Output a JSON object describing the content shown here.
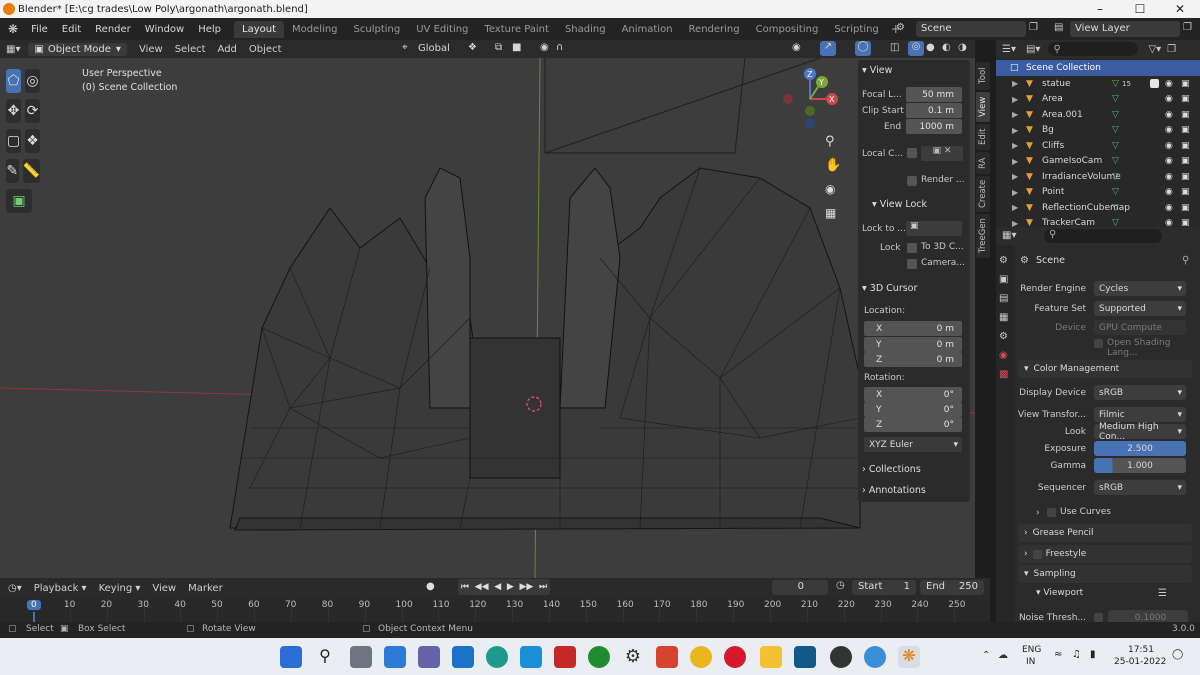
{
  "window": {
    "title": "Blender* [E:\\cg trades\\Low Poly\\argonath\\argonath.blend]"
  },
  "menu": [
    "File",
    "Edit",
    "Render",
    "Window",
    "Help"
  ],
  "workspaces": [
    "Layout",
    "Modeling",
    "Sculpting",
    "UV Editing",
    "Texture Paint",
    "Shading",
    "Animation",
    "Rendering",
    "Compositing",
    "Scripting"
  ],
  "active_workspace": "Layout",
  "scene_name": "Scene",
  "view_layer": "View Layer",
  "viewport_header": {
    "mode": "Object Mode",
    "menus": [
      "View",
      "Select",
      "Add",
      "Object"
    ],
    "orientation": "Global"
  },
  "viewport_overlay": {
    "line1": "User Perspective",
    "line2": "(0) Scene Collection"
  },
  "npanel": {
    "view_title": "View",
    "focal_label": "Focal L...",
    "focal_value": "50 mm",
    "clip_start_label": "Clip Start",
    "clip_start_value": "0.1 m",
    "end_label": "End",
    "end_value": "1000 m",
    "local_camera_label": "Local C...",
    "render_region_label": "Render ...",
    "view_lock_title": "View Lock",
    "lock_to_label": "Lock to ...",
    "lock_label": "Lock",
    "to_3d_cursor": "To 3D C...",
    "camera_label": "Camera...",
    "cursor_title": "3D Cursor",
    "location_label": "Location:",
    "loc": [
      {
        "axis": "X",
        "value": "0 m"
      },
      {
        "axis": "Y",
        "value": "0 m"
      },
      {
        "axis": "Z",
        "value": "0 m"
      }
    ],
    "rotation_label": "Rotation:",
    "rot": [
      {
        "axis": "X",
        "value": "0°"
      },
      {
        "axis": "Y",
        "value": "0°"
      },
      {
        "axis": "Z",
        "value": "0°"
      }
    ],
    "rotation_mode": "XYZ Euler",
    "collections_label": "Collections",
    "annotations_label": "Annotations"
  },
  "side_tabs": [
    "Tool",
    "View",
    "Edit",
    "RA",
    "Create",
    "TreeGen"
  ],
  "outliner": {
    "root": "Scene Collection",
    "items": [
      "statue",
      "Area",
      "Area.001",
      "Bg",
      "Cliffs",
      "GameIsoCam",
      "IrradianceVolume",
      "Point",
      "ReflectionCubemap",
      "TrackerCam"
    ],
    "statue_badge": "15"
  },
  "properties": {
    "context": "Scene",
    "render_engine_label": "Render Engine",
    "render_engine": "Cycles",
    "feature_set_label": "Feature Set",
    "feature_set": "Supported",
    "device_label": "Device",
    "device": "GPU Compute",
    "osl_label": "Open Shading Lang...",
    "color_mgmt_title": "Color Management",
    "display_device_label": "Display Device",
    "display_device": "sRGB",
    "view_transform_label": "View Transfor...",
    "view_transform": "Filmic",
    "look_label": "Look",
    "look": "Medium High Con...",
    "exposure_label": "Exposure",
    "exposure": "2.500",
    "gamma_label": "Gamma",
    "gamma": "1.000",
    "sequencer_label": "Sequencer",
    "sequencer": "sRGB",
    "use_curves_label": "Use Curves",
    "grease_pencil_title": "Grease Pencil",
    "freestyle_title": "Freestyle",
    "sampling_title": "Sampling",
    "viewport_sub_title": "Viewport",
    "noise_label": "Noise Thresh...",
    "noise_value": "0.1000"
  },
  "timeline": {
    "menus": [
      "Playback",
      "Keying",
      "View",
      "Marker"
    ],
    "current_frame": "0",
    "start_label": "Start",
    "start_value": "1",
    "end_label": "End",
    "end_value": "250",
    "ticks": [
      "0",
      "10",
      "20",
      "30",
      "40",
      "50",
      "60",
      "70",
      "80",
      "90",
      "100",
      "110",
      "120",
      "130",
      "140",
      "150",
      "160",
      "170",
      "180",
      "190",
      "200",
      "210",
      "220",
      "230",
      "240",
      "250"
    ]
  },
  "statusbar": {
    "select": "Select",
    "box_select": "Box Select",
    "rotate_view": "Rotate View",
    "context_menu": "Object Context Menu",
    "version": "3.0.0"
  },
  "taskbar": {
    "lang1": "ENG",
    "lang2": "IN",
    "time": "17:51",
    "date": "25-01-2022"
  },
  "colors": {
    "accent": "#4772b3",
    "active_header": "#3a3a3a",
    "viewport_bg": "#3d3d3d",
    "selection": "#3b5ca0"
  }
}
